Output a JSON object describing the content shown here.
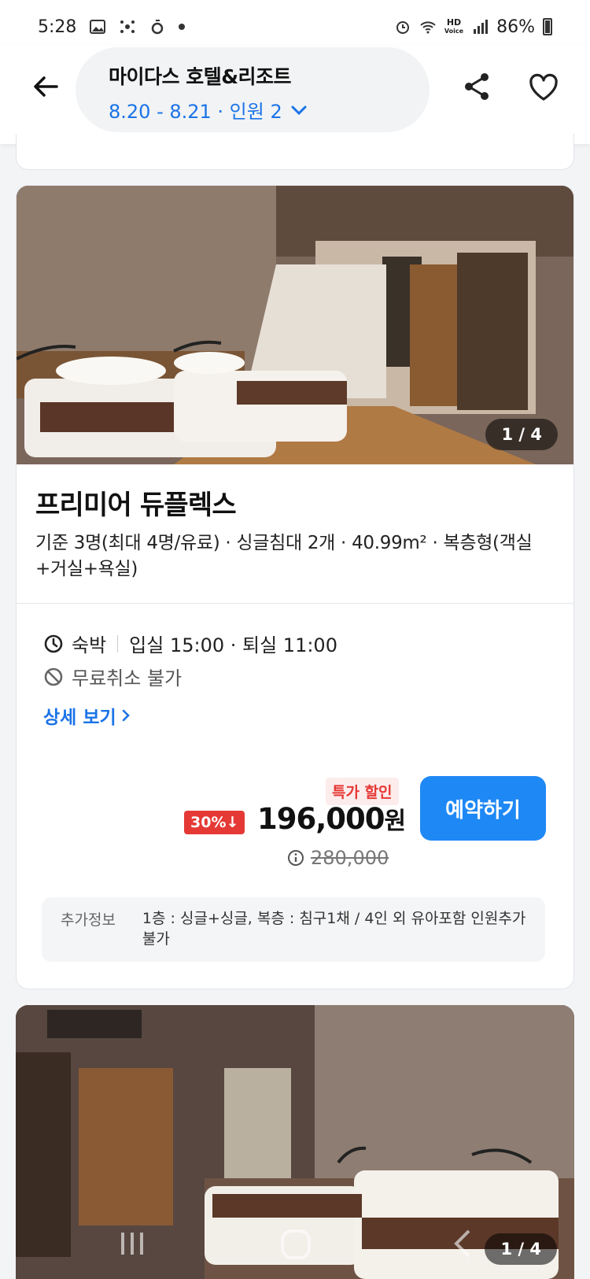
{
  "status_bar": {
    "time": "5:28",
    "battery": "86%",
    "hd_label": "HD",
    "voice_label": "Voice"
  },
  "header": {
    "hotel_name": "마이다스 호텔&리조트",
    "dates_guests": "8.20 - 8.21 · 인원 2"
  },
  "room": {
    "photo_counter": "1 / 4",
    "title": "프리미어 듀플렉스",
    "description": "기준 3명(최대 4명/유료) · 싱글침대 2개 · 40.99m² · 복층형(객실+거실+욕실)",
    "stay_type": "숙박",
    "check_times": "입실 15:00 · 퇴실 11:00",
    "cancel_policy": "무료취소 불가",
    "detail_link": "상세 보기",
    "special_badge": "특가 할인",
    "discount": "30%↓",
    "price": "196,000",
    "price_unit": "원",
    "original_price": "280,000",
    "book_button": "예약하기",
    "extra_label": "추가정보",
    "extra_text": "1층 : 싱글+싱글, 복층 : 침구1채 / 4인 외 유아포함 인원추가 불가"
  },
  "next_room": {
    "photo_counter": "1 / 4"
  },
  "colors": {
    "accent": "#1e88f5",
    "link": "#1a73e8",
    "sale": "#e53935"
  }
}
